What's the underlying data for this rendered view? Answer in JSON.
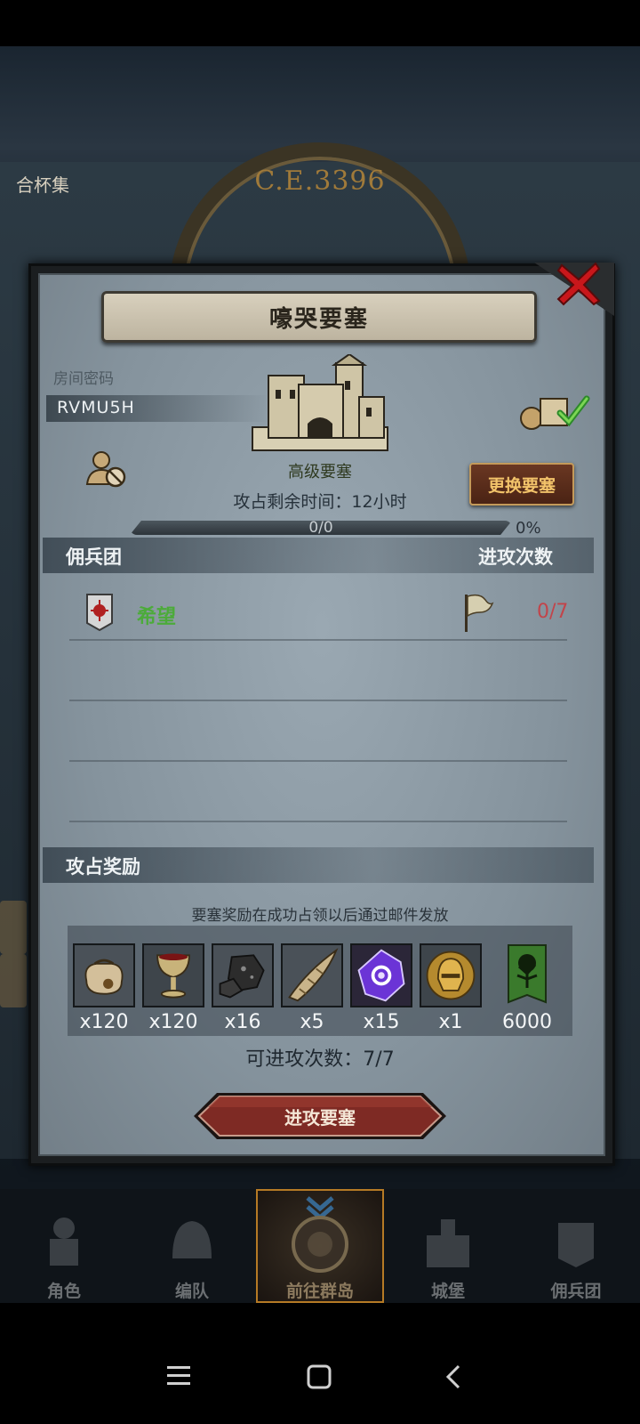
{
  "background": {
    "era": "C.E.3396",
    "side_label": "合杯集"
  },
  "dialog": {
    "title": "嚎哭要塞",
    "room_code_label": "房间密码",
    "room_code": "RVMU5H",
    "fortress_level": "高级要塞",
    "capture_time_text": "攻占剩余时间：12小时",
    "change_fortress_label": "更换要塞",
    "progress": {
      "text": "0/0",
      "percent": "0%",
      "fraction": 0
    },
    "mercenary_header": "佣兵团",
    "attack_times_header": "进攻次数",
    "mercenaries": [
      {
        "name": "希望",
        "attacks": "0/7"
      }
    ],
    "rewards_header": "攻占奖励",
    "rewards_note": "要塞奖励在成功占领以后通过邮件发放",
    "rewards": [
      {
        "icon": "pouch-icon",
        "qty": "x120"
      },
      {
        "icon": "goblet-icon",
        "qty": "x120"
      },
      {
        "icon": "ore-icon",
        "qty": "x16"
      },
      {
        "icon": "horn-icon",
        "qty": "x5"
      },
      {
        "icon": "purple-gem-icon",
        "qty": "x15"
      },
      {
        "icon": "golden-helmet-icon",
        "qty": "x1"
      },
      {
        "icon": "tree-banner-icon",
        "qty": "6000"
      }
    ],
    "attacks_left_text": "可进攻次数：7/7",
    "attack_button": "进攻要塞"
  },
  "tabs": [
    {
      "label": "角色"
    },
    {
      "label": "编队"
    },
    {
      "label": "前往群岛"
    },
    {
      "label": "城堡"
    },
    {
      "label": "佣兵团"
    }
  ],
  "colors": {
    "merc_name": "#4cab3a",
    "attack_count": "#c2444a",
    "tab_active_border": "#b57a25"
  }
}
